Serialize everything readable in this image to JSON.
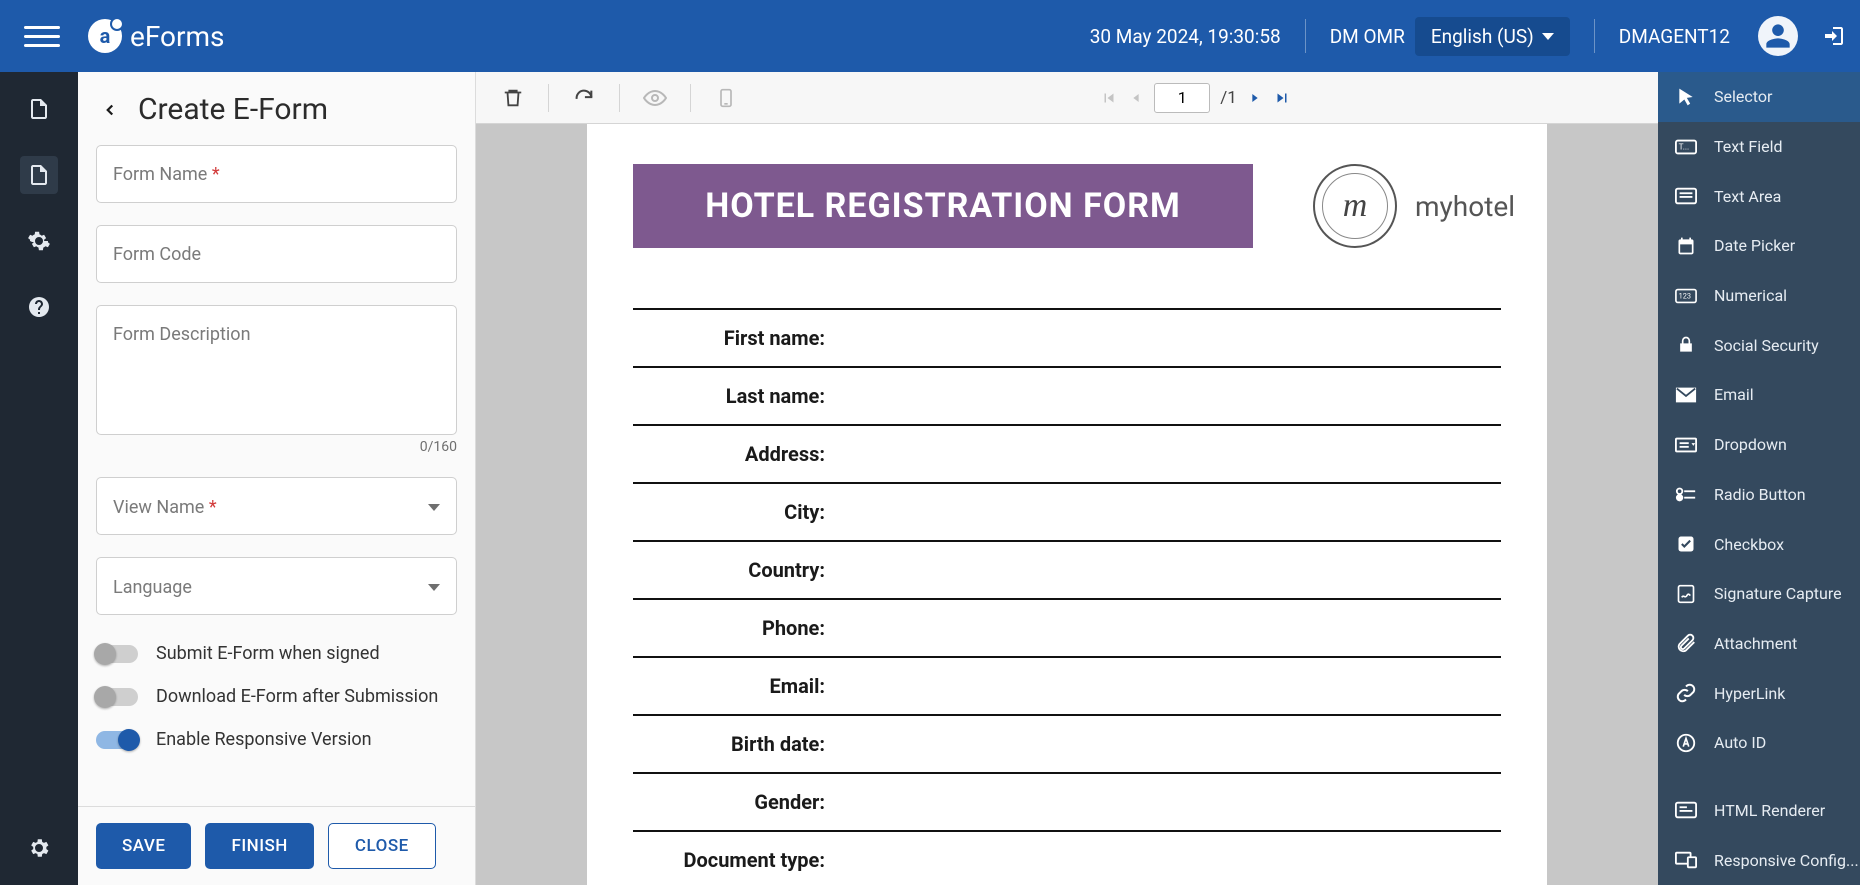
{
  "header": {
    "brand": "eForms",
    "datetime": "30 May 2024, 19:30:58",
    "org": "DM OMR",
    "language": "English (US)",
    "user": "DMAGENT12"
  },
  "sidebar": {
    "title": "Create E-Form",
    "form_name_label": "Form Name ",
    "form_code_label": "Form Code",
    "form_desc_label": "Form Description",
    "char_count": "0/160",
    "view_name_label": "View Name ",
    "language_label": "Language",
    "switch_submit": "Submit E-Form when signed",
    "switch_download": "Download E-Form after Submission",
    "switch_responsive": "Enable Responsive Version",
    "buttons": {
      "save": "SAVE",
      "finish": "FINISH",
      "close": "CLOSE"
    }
  },
  "toolbar": {
    "page_current": "1",
    "page_total": "/1"
  },
  "document": {
    "title": "HOTEL REGISTRATION FORM",
    "logo_text": "myhotel",
    "logo_initial": "m",
    "rows": [
      "First name:",
      "Last name:",
      "Address:",
      "City:",
      "Country:",
      "Phone:",
      "Email:",
      "Birth date:",
      "Gender:",
      "Document type:"
    ]
  },
  "palette": [
    {
      "label": "Selector",
      "icon": "cursor",
      "active": true
    },
    {
      "label": "Text Field",
      "icon": "textfield"
    },
    {
      "label": "Text Area",
      "icon": "textarea"
    },
    {
      "label": "Date Picker",
      "icon": "calendar"
    },
    {
      "label": "Numerical",
      "icon": "number"
    },
    {
      "label": "Social Security",
      "icon": "lock"
    },
    {
      "label": "Email",
      "icon": "mail"
    },
    {
      "label": "Dropdown",
      "icon": "dropdown"
    },
    {
      "label": "Radio Button",
      "icon": "radio"
    },
    {
      "label": "Checkbox",
      "icon": "checkbox"
    },
    {
      "label": "Signature Capture",
      "icon": "signature"
    },
    {
      "label": "Attachment",
      "icon": "attach"
    },
    {
      "label": "HyperLink",
      "icon": "link"
    },
    {
      "label": "Auto ID",
      "icon": "autoid"
    },
    {
      "label": "_gap"
    },
    {
      "label": "HTML Renderer",
      "icon": "html"
    },
    {
      "label": "Responsive Config...",
      "icon": "responsive"
    }
  ]
}
